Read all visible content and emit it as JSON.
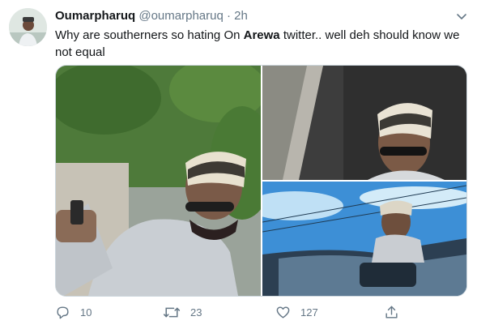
{
  "tweet": {
    "display_name": "Oumarpharuq",
    "handle": "@oumarpharuq",
    "separator": "·",
    "time": "2h",
    "text_part1": "Why are southerners so hating On ",
    "text_bold": "Arewa",
    "text_part2": " twitter..  well deh should know we not equal"
  },
  "actions": {
    "replies": "10",
    "retweets": "23",
    "likes": "127"
  },
  "icons": [
    "chevron-down-icon",
    "reply-icon",
    "retweet-icon",
    "like-icon",
    "share-icon"
  ],
  "colors": {
    "text": "#14171a",
    "secondary": "#657786",
    "border": "#ccd6dd"
  }
}
